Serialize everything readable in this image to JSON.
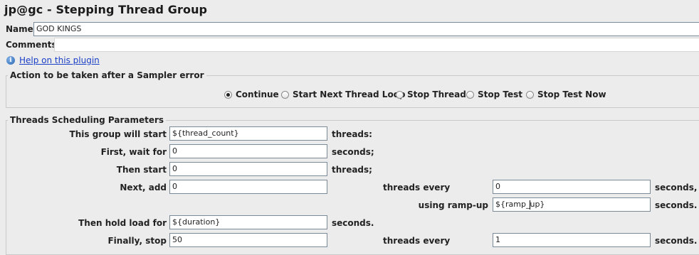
{
  "title": "jp@gc - Stepping Thread Group",
  "name": {
    "label": "Name:",
    "value": "GOD KINGS"
  },
  "comments": {
    "label": "Comments:",
    "value": ""
  },
  "help": {
    "icon": "info-icon",
    "glyph": "i",
    "text": "Help on this plugin"
  },
  "sampler_error": {
    "title": "Action to be taken after a Sampler error",
    "options": [
      {
        "label": "Continue",
        "selected": true
      },
      {
        "label": "Start Next Thread Loop",
        "selected": false
      },
      {
        "label": "Stop Thread",
        "selected": false
      },
      {
        "label": "Stop Test",
        "selected": false
      },
      {
        "label": "Stop Test Now",
        "selected": false
      }
    ]
  },
  "scheduling": {
    "title": "Threads Scheduling Parameters",
    "start": {
      "label": "This group will start",
      "value": "${thread_count}",
      "unit": "threads:"
    },
    "wait": {
      "label": "First, wait for",
      "value": "0",
      "unit": "seconds;"
    },
    "then_start": {
      "label": "Then start",
      "value": "0",
      "unit": "threads;"
    },
    "next_add": {
      "label": "Next, add",
      "value": "0",
      "every_label": "threads every",
      "every_value": "0",
      "unit": "seconds,"
    },
    "ramp_up": {
      "label": "using ramp-up",
      "value_before": "${ramp_",
      "value_after": "up}",
      "unit": "seconds."
    },
    "hold": {
      "label": "Then hold load for",
      "value": "${duration}",
      "unit": "seconds."
    },
    "stop": {
      "label": "Finally, stop",
      "value": "50",
      "every_label": "threads every",
      "every_value": "1",
      "unit": "seconds."
    }
  }
}
